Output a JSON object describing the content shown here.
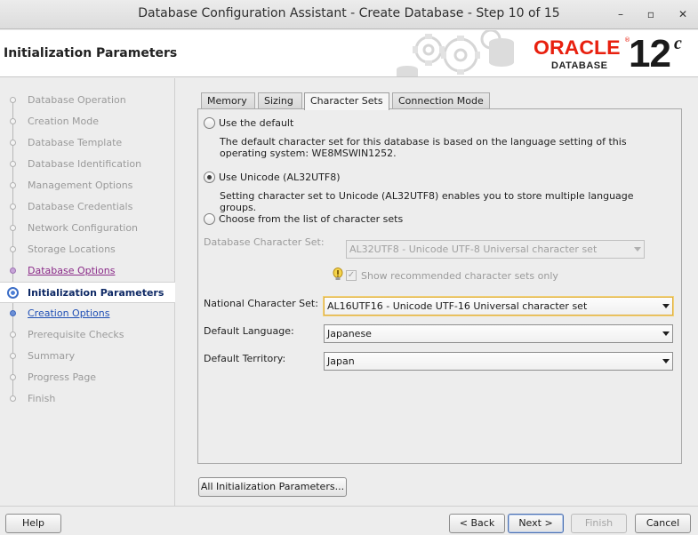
{
  "window": {
    "title": "Database Configuration Assistant - Create Database - Step 10 of 15",
    "minimize": "–",
    "maximize": "▫",
    "close": "✕"
  },
  "header": {
    "page_title": "Initialization Parameters",
    "brand": "ORACLE",
    "brand_mark": "®",
    "brand_sub": "DATABASE",
    "version": "12",
    "version_suffix": "c"
  },
  "steps": [
    {
      "label": "Database Operation",
      "state": "disabled"
    },
    {
      "label": "Creation Mode",
      "state": "disabled"
    },
    {
      "label": "Database Template",
      "state": "disabled"
    },
    {
      "label": "Database Identification",
      "state": "disabled"
    },
    {
      "label": "Management Options",
      "state": "disabled"
    },
    {
      "label": "Database Credentials",
      "state": "disabled"
    },
    {
      "label": "Network Configuration",
      "state": "disabled"
    },
    {
      "label": "Storage Locations",
      "state": "disabled"
    },
    {
      "label": "Database Options",
      "state": "done"
    },
    {
      "label": "Initialization Parameters",
      "state": "current"
    },
    {
      "label": "Creation Options",
      "state": "next"
    },
    {
      "label": "Prerequisite Checks",
      "state": "disabled"
    },
    {
      "label": "Summary",
      "state": "disabled"
    },
    {
      "label": "Progress Page",
      "state": "disabled"
    },
    {
      "label": "Finish",
      "state": "disabled"
    }
  ],
  "tabs": [
    {
      "label": "Memory",
      "active": false
    },
    {
      "label": "Sizing",
      "active": false
    },
    {
      "label": "Character Sets",
      "active": true
    },
    {
      "label": "Connection Mode",
      "active": false
    }
  ],
  "charsets": {
    "use_default_label": "Use the default",
    "use_default_desc": "The default character set for this database is based on the language setting of this operating system: WE8MSWIN1252.",
    "use_unicode_label": "Use Unicode (AL32UTF8)",
    "use_unicode_desc": "Setting character set to Unicode (AL32UTF8) enables you to store multiple language groups.",
    "choose_label": "Choose from the list of character sets",
    "selected_option": "use_unicode",
    "db_charset_label": "Database Character Set:",
    "db_charset_value": "AL32UTF8 - Unicode UTF-8 Universal character set",
    "show_recommended_label": "Show recommended character sets only",
    "show_recommended_checked": true,
    "national_label": "National Character Set:",
    "national_value": "AL16UTF16 - Unicode UTF-16 Universal character set",
    "language_label": "Default Language:",
    "language_value": "Japanese",
    "territory_label": "Default Territory:",
    "territory_value": "Japan"
  },
  "buttons": {
    "all_params": "All Initialization Parameters...",
    "help": "Help",
    "back": "< Back",
    "next": "Next >",
    "finish": "Finish",
    "cancel": "Cancel"
  },
  "colors": {
    "oracle_red": "#e8200f",
    "current_step": "#0f2a66",
    "link_blue": "#1f4fb5",
    "visited_purple": "#8a2a88"
  }
}
